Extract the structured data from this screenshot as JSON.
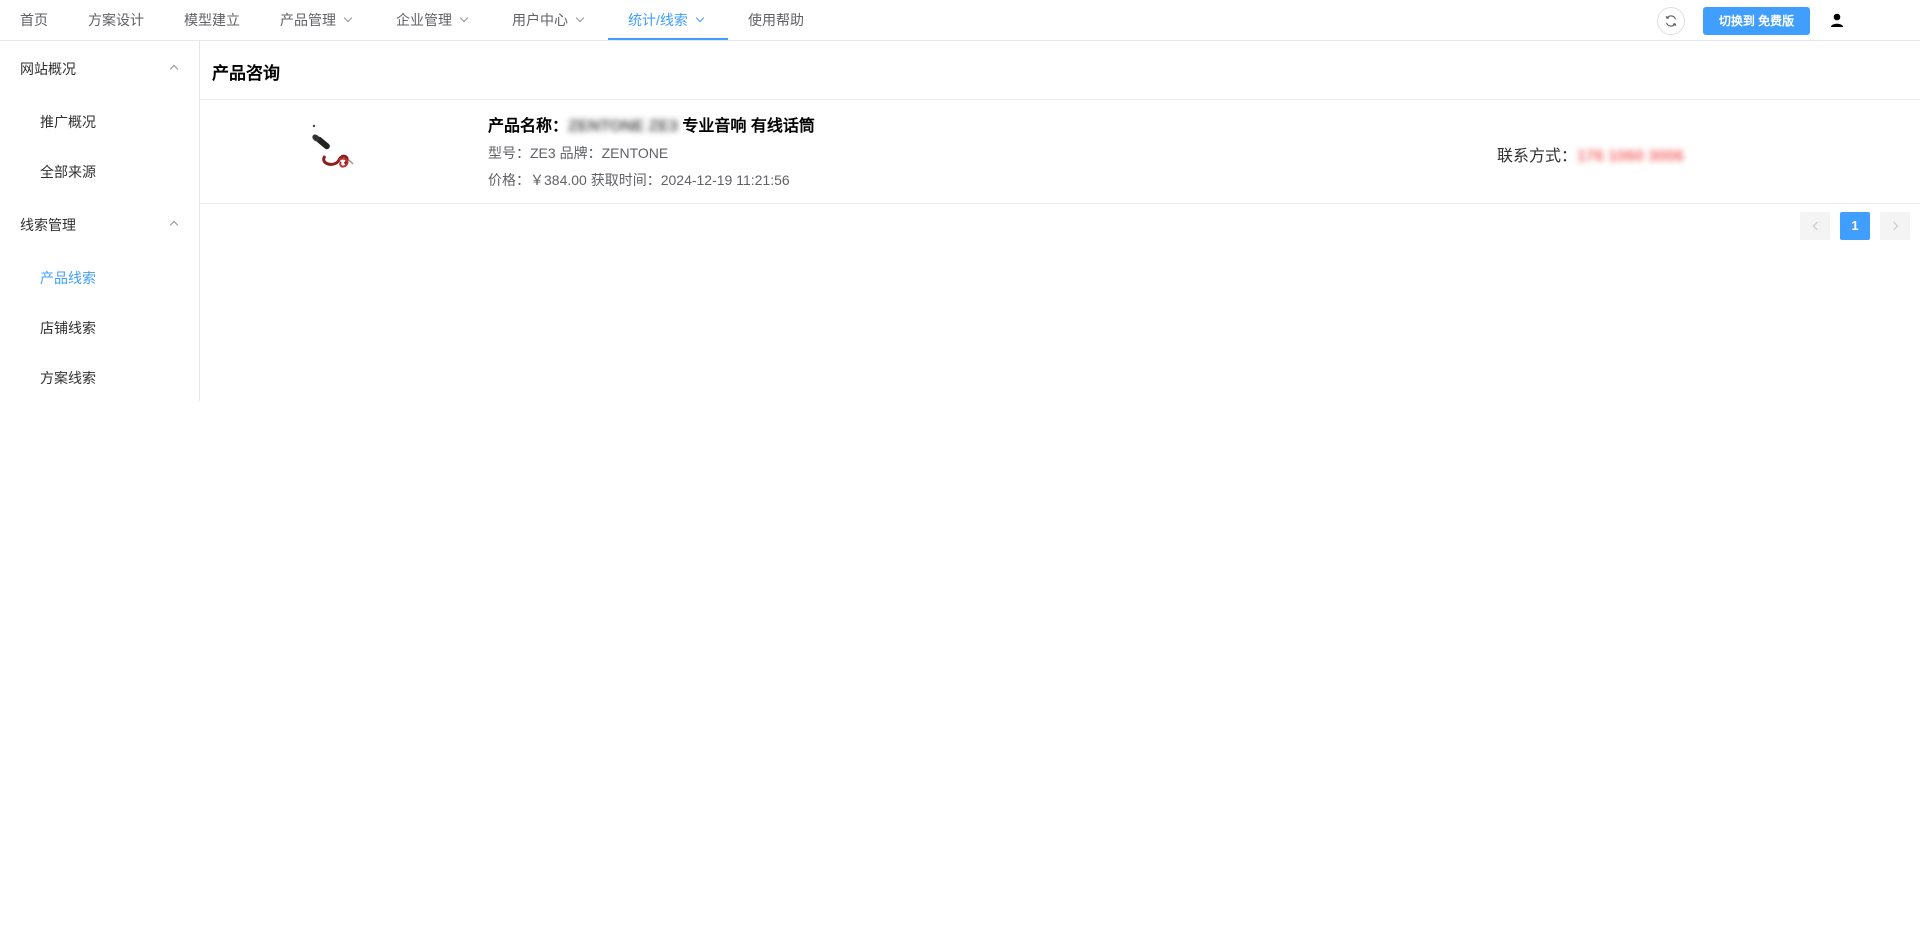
{
  "nav": {
    "items": [
      {
        "label": "首页"
      },
      {
        "label": "方案设计"
      },
      {
        "label": "模型建立"
      },
      {
        "label": "产品管理"
      },
      {
        "label": "企业管理"
      },
      {
        "label": "用户中心"
      },
      {
        "label": "统计/线索"
      },
      {
        "label": "使用帮助"
      }
    ],
    "active_index": 6,
    "switch_label": "切换到 免费版",
    "accent_color": "#409eff"
  },
  "sidebar": {
    "groups": [
      {
        "label": "网站概况",
        "items": [
          {
            "label": "推广概况"
          },
          {
            "label": "全部来源"
          }
        ]
      },
      {
        "label": "线索管理",
        "items": [
          {
            "label": "产品线索"
          },
          {
            "label": "店铺线索"
          },
          {
            "label": "方案线索"
          }
        ]
      }
    ],
    "active_item": "产品线索"
  },
  "main": {
    "title": "产品咨询",
    "leads": [
      {
        "name_label": "产品名称：",
        "name_blurred": "ZENTONE ZE3",
        "name_rest": " 专业音响 有线话筒",
        "model_label": "型号：",
        "model": "ZE3",
        "brand_label": " 品牌：",
        "brand": "ZENTONE",
        "price_label": "价格：",
        "price": "￥384.00",
        "time_label": " 获取时间：",
        "time": "2024-12-19 11:21:56",
        "contact_label": "联系方式：",
        "contact": "176 1060 3006",
        "thumbnail_icon": "microphone-cable-icon"
      }
    ],
    "pagination": {
      "current": "1"
    }
  }
}
